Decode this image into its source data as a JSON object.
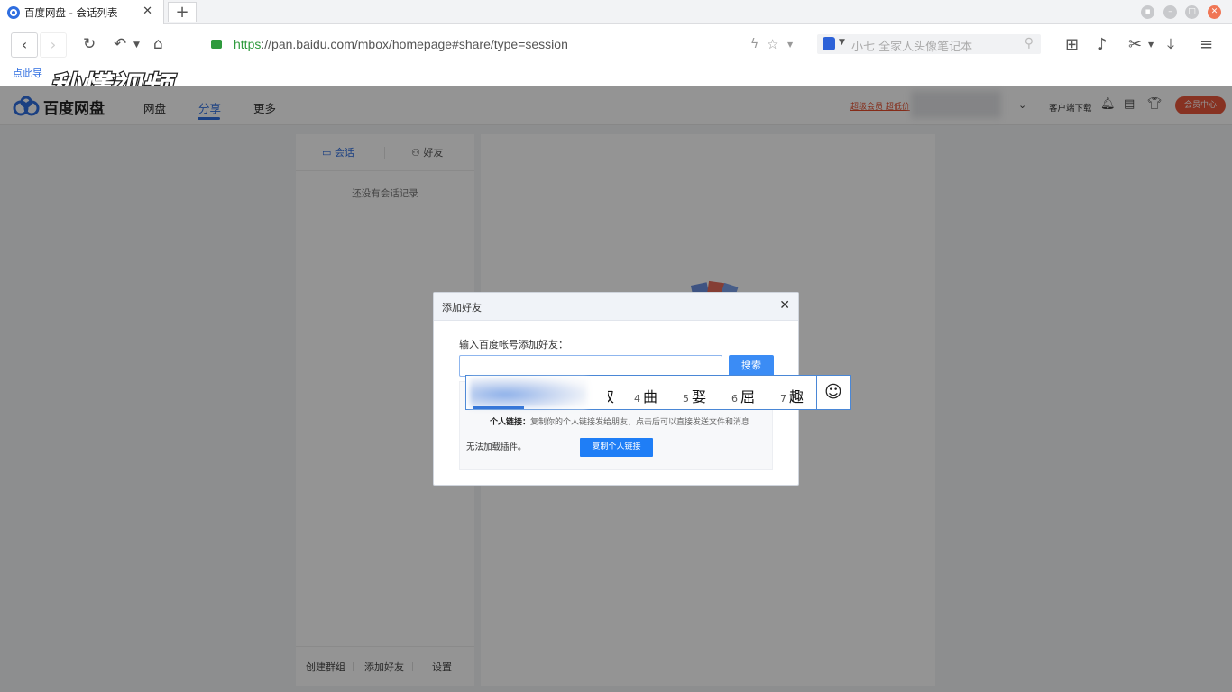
{
  "browser": {
    "tab_title": "百度网盘 - 会话列表",
    "tab_close": "✕",
    "new_tab": "+",
    "url_scheme": "https",
    "url_rest": "://pan.baidu.com/mbox/homepage#share/type=session",
    "search_placeholder": "小七 全家人头像笔记本",
    "bookmark_hint": "点此导",
    "watermark": "秒懂视频"
  },
  "app": {
    "logo_text": "百度网盘",
    "nav": [
      "网盘",
      "分享",
      "更多"
    ],
    "active_nav": "分享",
    "promo": "超级会员 超低价",
    "client_download": "客户端下载",
    "vip_center": "会员中心"
  },
  "session_panel": {
    "tab_session": "会话",
    "tab_friends": "好友",
    "empty_text": "还没有会话记录",
    "footer": [
      "创建群组",
      "添加好友",
      "设置"
    ]
  },
  "dialog": {
    "title": "添加好友",
    "close": "✕",
    "label": "输入百度帐号添加好友：",
    "input_value": "",
    "search_button": "搜索",
    "personal_link_label": "个人链接：",
    "personal_link_desc": "复制你的个人链接发给朋友，点击后可以直接发送文件和消息",
    "plugin_msg": "无法加载插件。",
    "copy_link_button": "复制个人链接"
  },
  "ime": {
    "partial_char": "奴",
    "candidates": [
      {
        "num": "4",
        "char": "曲"
      },
      {
        "num": "5",
        "char": "娶"
      },
      {
        "num": "6",
        "char": "屈"
      },
      {
        "num": "7",
        "char": "趣"
      }
    ],
    "emoji": "☺"
  },
  "colors": {
    "accent": "#2f6ee0",
    "button_blue": "#3b8cf5",
    "vip_red": "#e9563b",
    "https_green": "#2e9a3d"
  },
  "icons": [
    "back-icon",
    "forward-icon",
    "refresh-icon",
    "undo-icon",
    "home-icon",
    "lock-icon",
    "lightning-icon",
    "star-icon",
    "search-engine-icon",
    "magnifier-icon",
    "extensions-icon",
    "sound-icon",
    "scissors-icon",
    "download-icon",
    "menu-icon",
    "bell-icon",
    "clipboard-icon",
    "shirt-icon",
    "chat-icon",
    "friends-icon",
    "close-icon",
    "emoji-icon"
  ]
}
